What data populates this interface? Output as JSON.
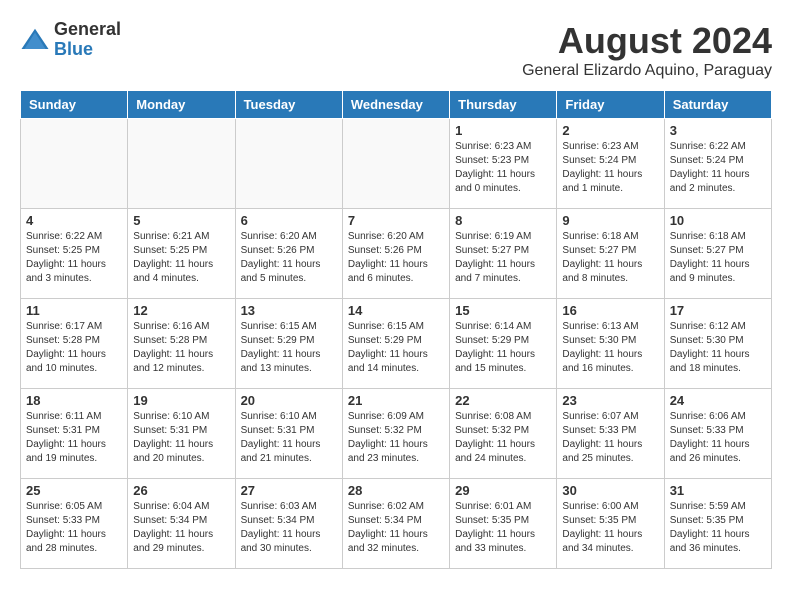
{
  "header": {
    "logo_general": "General",
    "logo_blue": "Blue",
    "month_title": "August 2024",
    "location": "General Elizardo Aquino, Paraguay"
  },
  "weekdays": [
    "Sunday",
    "Monday",
    "Tuesday",
    "Wednesday",
    "Thursday",
    "Friday",
    "Saturday"
  ],
  "weeks": [
    [
      {
        "day": "",
        "info": ""
      },
      {
        "day": "",
        "info": ""
      },
      {
        "day": "",
        "info": ""
      },
      {
        "day": "",
        "info": ""
      },
      {
        "day": "1",
        "info": "Sunrise: 6:23 AM\nSunset: 5:23 PM\nDaylight: 11 hours\nand 0 minutes."
      },
      {
        "day": "2",
        "info": "Sunrise: 6:23 AM\nSunset: 5:24 PM\nDaylight: 11 hours\nand 1 minute."
      },
      {
        "day": "3",
        "info": "Sunrise: 6:22 AM\nSunset: 5:24 PM\nDaylight: 11 hours\nand 2 minutes."
      }
    ],
    [
      {
        "day": "4",
        "info": "Sunrise: 6:22 AM\nSunset: 5:25 PM\nDaylight: 11 hours\nand 3 minutes."
      },
      {
        "day": "5",
        "info": "Sunrise: 6:21 AM\nSunset: 5:25 PM\nDaylight: 11 hours\nand 4 minutes."
      },
      {
        "day": "6",
        "info": "Sunrise: 6:20 AM\nSunset: 5:26 PM\nDaylight: 11 hours\nand 5 minutes."
      },
      {
        "day": "7",
        "info": "Sunrise: 6:20 AM\nSunset: 5:26 PM\nDaylight: 11 hours\nand 6 minutes."
      },
      {
        "day": "8",
        "info": "Sunrise: 6:19 AM\nSunset: 5:27 PM\nDaylight: 11 hours\nand 7 minutes."
      },
      {
        "day": "9",
        "info": "Sunrise: 6:18 AM\nSunset: 5:27 PM\nDaylight: 11 hours\nand 8 minutes."
      },
      {
        "day": "10",
        "info": "Sunrise: 6:18 AM\nSunset: 5:27 PM\nDaylight: 11 hours\nand 9 minutes."
      }
    ],
    [
      {
        "day": "11",
        "info": "Sunrise: 6:17 AM\nSunset: 5:28 PM\nDaylight: 11 hours\nand 10 minutes."
      },
      {
        "day": "12",
        "info": "Sunrise: 6:16 AM\nSunset: 5:28 PM\nDaylight: 11 hours\nand 12 minutes."
      },
      {
        "day": "13",
        "info": "Sunrise: 6:15 AM\nSunset: 5:29 PM\nDaylight: 11 hours\nand 13 minutes."
      },
      {
        "day": "14",
        "info": "Sunrise: 6:15 AM\nSunset: 5:29 PM\nDaylight: 11 hours\nand 14 minutes."
      },
      {
        "day": "15",
        "info": "Sunrise: 6:14 AM\nSunset: 5:29 PM\nDaylight: 11 hours\nand 15 minutes."
      },
      {
        "day": "16",
        "info": "Sunrise: 6:13 AM\nSunset: 5:30 PM\nDaylight: 11 hours\nand 16 minutes."
      },
      {
        "day": "17",
        "info": "Sunrise: 6:12 AM\nSunset: 5:30 PM\nDaylight: 11 hours\nand 18 minutes."
      }
    ],
    [
      {
        "day": "18",
        "info": "Sunrise: 6:11 AM\nSunset: 5:31 PM\nDaylight: 11 hours\nand 19 minutes."
      },
      {
        "day": "19",
        "info": "Sunrise: 6:10 AM\nSunset: 5:31 PM\nDaylight: 11 hours\nand 20 minutes."
      },
      {
        "day": "20",
        "info": "Sunrise: 6:10 AM\nSunset: 5:31 PM\nDaylight: 11 hours\nand 21 minutes."
      },
      {
        "day": "21",
        "info": "Sunrise: 6:09 AM\nSunset: 5:32 PM\nDaylight: 11 hours\nand 23 minutes."
      },
      {
        "day": "22",
        "info": "Sunrise: 6:08 AM\nSunset: 5:32 PM\nDaylight: 11 hours\nand 24 minutes."
      },
      {
        "day": "23",
        "info": "Sunrise: 6:07 AM\nSunset: 5:33 PM\nDaylight: 11 hours\nand 25 minutes."
      },
      {
        "day": "24",
        "info": "Sunrise: 6:06 AM\nSunset: 5:33 PM\nDaylight: 11 hours\nand 26 minutes."
      }
    ],
    [
      {
        "day": "25",
        "info": "Sunrise: 6:05 AM\nSunset: 5:33 PM\nDaylight: 11 hours\nand 28 minutes."
      },
      {
        "day": "26",
        "info": "Sunrise: 6:04 AM\nSunset: 5:34 PM\nDaylight: 11 hours\nand 29 minutes."
      },
      {
        "day": "27",
        "info": "Sunrise: 6:03 AM\nSunset: 5:34 PM\nDaylight: 11 hours\nand 30 minutes."
      },
      {
        "day": "28",
        "info": "Sunrise: 6:02 AM\nSunset: 5:34 PM\nDaylight: 11 hours\nand 32 minutes."
      },
      {
        "day": "29",
        "info": "Sunrise: 6:01 AM\nSunset: 5:35 PM\nDaylight: 11 hours\nand 33 minutes."
      },
      {
        "day": "30",
        "info": "Sunrise: 6:00 AM\nSunset: 5:35 PM\nDaylight: 11 hours\nand 34 minutes."
      },
      {
        "day": "31",
        "info": "Sunrise: 5:59 AM\nSunset: 5:35 PM\nDaylight: 11 hours\nand 36 minutes."
      }
    ]
  ]
}
